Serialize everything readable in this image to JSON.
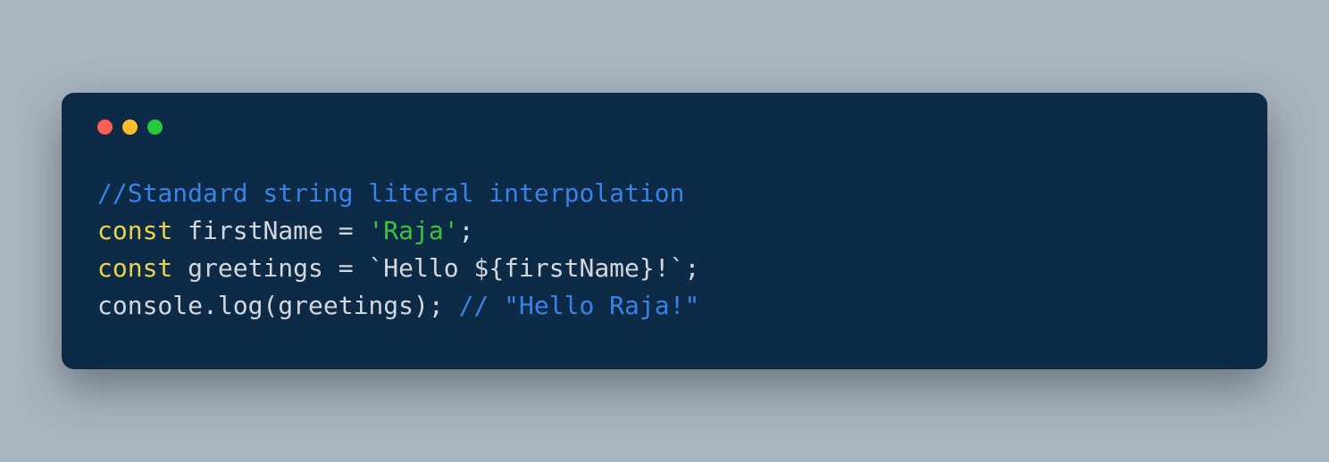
{
  "window": {
    "controls": {
      "close_color": "#ff5f56",
      "minimize_color": "#ffbd2e",
      "maximize_color": "#27c93f"
    }
  },
  "code": {
    "line1": {
      "comment": "//Standard string literal interpolation"
    },
    "line2": {
      "keyword": "const",
      "space1": " ",
      "ident": "firstName ",
      "equals": "=",
      "space2": " ",
      "string": "'Raja'",
      "semi": ";"
    },
    "line3": {
      "keyword": "const",
      "space1": " ",
      "ident": "greetings ",
      "equals": "=",
      "space2": " ",
      "template": "`Hello ${firstName}!`",
      "semi": ";"
    },
    "line4": {
      "call": "console.log(greetings); ",
      "comment": "// \"Hello Raja!\""
    }
  }
}
